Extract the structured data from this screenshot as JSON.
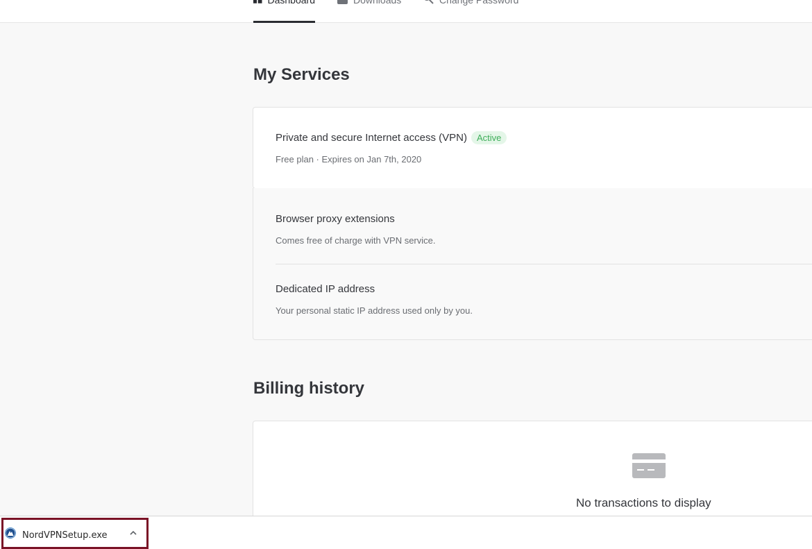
{
  "nav": {
    "tabs": [
      {
        "label": "Dashboard",
        "active": true
      },
      {
        "label": "Downloads",
        "active": false
      },
      {
        "label": "Change Password",
        "active": false
      }
    ]
  },
  "services": {
    "title": "My Services",
    "vpn": {
      "title": "Private and secure Internet access (VPN)",
      "badge": "Active",
      "subtitle": "Free plan · Expires on Jan 7th, 2020"
    },
    "proxy": {
      "title": "Browser proxy extensions",
      "subtitle": "Comes free of charge with VPN service."
    },
    "dedicated_ip": {
      "title": "Dedicated IP address",
      "subtitle": "Your personal static IP address used only by you."
    }
  },
  "billing": {
    "title": "Billing history",
    "empty_text": "No transactions to display"
  },
  "download_bar": {
    "file_name": "NordVPNSetup.exe"
  },
  "colors": {
    "accent_border": "#7a1226",
    "badge_green": "#3fae5a",
    "badge_bg": "#e4f6e8"
  },
  "icons": {
    "dashboard": "dashboard-icon",
    "downloads": "download-icon",
    "password": "key-icon",
    "empty": "credit-card-icon",
    "file": "nordvpn-logo-icon",
    "chevron": "chevron-up-icon"
  }
}
